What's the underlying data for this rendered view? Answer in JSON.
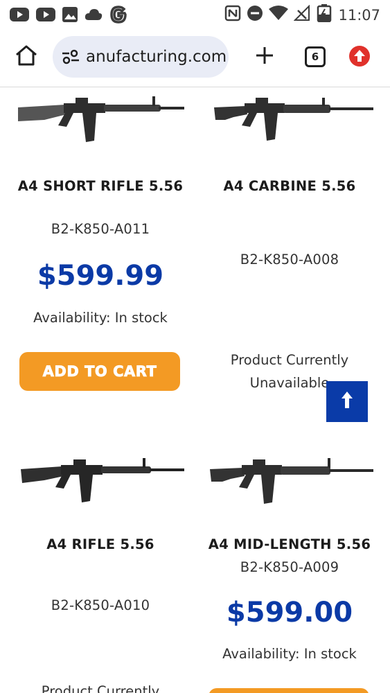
{
  "status_bar": {
    "time": "11:07",
    "left_icons": [
      "youtube-icon",
      "youtube-icon",
      "gallery-icon",
      "cloud-icon",
      "google-icon"
    ],
    "right_icons": [
      "nfc-icon",
      "do-not-disturb-icon",
      "wifi-icon",
      "no-signal-icon",
      "battery-charging-icon"
    ]
  },
  "browser": {
    "url": "anufacturing.com",
    "tab_count": "6",
    "icons": [
      "home-icon",
      "site-settings-icon",
      "new-tab-icon",
      "tab-switcher-icon",
      "update-icon"
    ]
  },
  "products": [
    {
      "name": "A4 SHORT RIFLE 5.56",
      "sku": "B2-K850-A011",
      "price": "$599.99",
      "availability": "Availability: In stock",
      "button": "ADD TO CART"
    },
    {
      "name": "A4 CARBINE 5.56",
      "sku": "B2-K850-A008",
      "unavailable": "Product Currently Unavailable"
    },
    {
      "name": "A4 RIFLE 5.56",
      "sku": "B2-K850-A010",
      "unavailable": "Product Currently"
    },
    {
      "name": "A4 MID-LENGTH 5.56",
      "sku": "B2-K850-A009",
      "price": "$599.00",
      "availability": "Availability: In stock"
    }
  ],
  "scroll_top": {
    "icon": "arrow-up-icon"
  },
  "colors": {
    "price": "#0b3aa6",
    "button": "#f39a24",
    "scroll_top": "#0a3ba8"
  }
}
